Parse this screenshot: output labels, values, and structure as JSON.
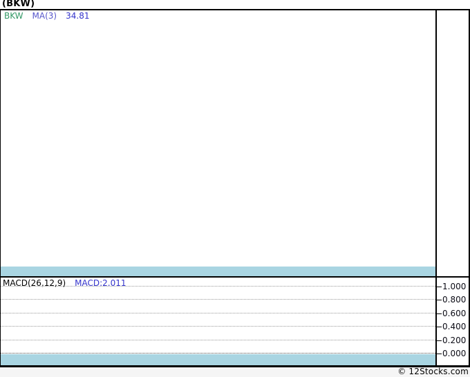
{
  "page_title": "(BKW)",
  "price_panel": {
    "legend": [
      {
        "label": "BKW",
        "color": "#339966"
      },
      {
        "label": "MA(3)",
        "color": "#5656CB"
      },
      {
        "label": "34.81",
        "color": "#3333CC"
      }
    ]
  },
  "macd_panel": {
    "legend": [
      {
        "label": "MACD(26,12,9)",
        "color": "#000000"
      },
      {
        "label": "MACD:2.011",
        "color": "#3333CC"
      }
    ],
    "axis_ticks": [
      "1.000",
      "0.800",
      "0.600",
      "0.400",
      "0.200",
      "0.000"
    ]
  },
  "footer": {
    "credit": "© 12Stocks.com"
  },
  "colors": {
    "band": "#A9D5E2",
    "grid": "#999999",
    "zero_line": "#444444",
    "frame": "#000000"
  },
  "chart_data": [
    {
      "type": "line",
      "panel": "price",
      "title": "(BKW)",
      "legend_position": "top-left",
      "series": [
        {
          "name": "BKW",
          "color": "#339966",
          "values": []
        },
        {
          "name": "MA(3)",
          "color": "#5656CB",
          "values": [],
          "last_value": 34.81
        }
      ]
    },
    {
      "type": "line",
      "panel": "macd",
      "title": "MACD(26,12,9)",
      "legend_position": "top-left",
      "grid": true,
      "y_ticks": [
        1.0,
        0.8,
        0.6,
        0.4,
        0.2,
        0.0
      ],
      "ylim": [
        0.0,
        1.05
      ],
      "series": [
        {
          "name": "MACD",
          "color": "#3333CC",
          "values": [],
          "last_value": 2.011
        }
      ]
    }
  ]
}
